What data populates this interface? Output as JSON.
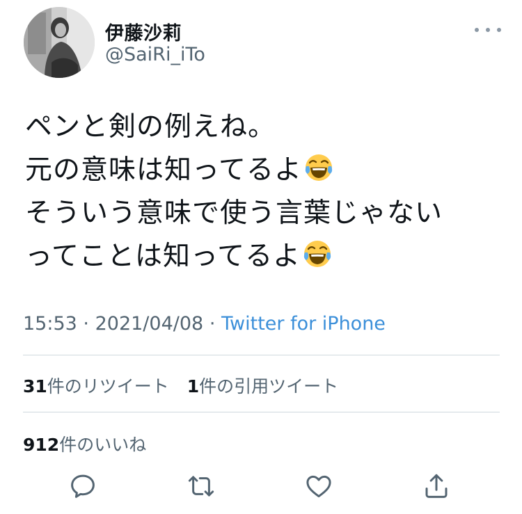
{
  "user": {
    "display_name": "伊藤沙莉",
    "handle": "@SaiRi_iTo"
  },
  "more_menu": {
    "icon": "more-dots-icon"
  },
  "tweet": {
    "lines": [
      "ペンと剣の例えね。",
      "元の意味は知ってるよ",
      "そういう意味で使う言葉じゃない",
      "ってことは知ってるよ"
    ],
    "emoji": "face-with-tears-of-joy"
  },
  "meta": {
    "time": "15:53",
    "date": "2021/04/08",
    "separator": "·",
    "source": "Twitter for iPhone"
  },
  "stats": {
    "retweets_count": "31",
    "retweets_label": "件のリツイート",
    "quotes_count": "1",
    "quotes_label": "件の引用ツイート",
    "likes_count": "912",
    "likes_label": "件のいいね"
  },
  "actions": [
    {
      "name": "reply",
      "icon": "reply-icon"
    },
    {
      "name": "retweet",
      "icon": "retweet-icon"
    },
    {
      "name": "like",
      "icon": "heart-icon"
    },
    {
      "name": "share",
      "icon": "share-icon"
    }
  ],
  "colors": {
    "text": "#0f1419",
    "secondary": "#536471",
    "link": "#3b8fd9",
    "icon": "#536471",
    "divider": "#cfd9de"
  }
}
